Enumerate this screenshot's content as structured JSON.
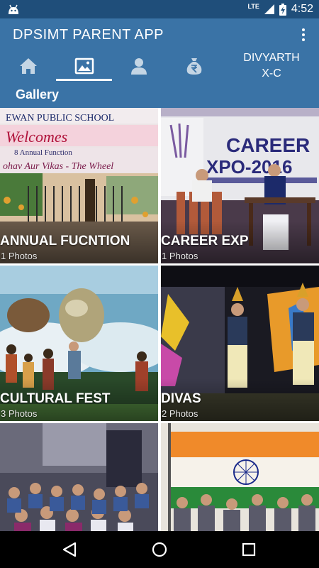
{
  "status_bar": {
    "network": "LTE",
    "time": "4:52"
  },
  "app_bar": {
    "title": "DPSIMT PARENT APP",
    "tabs": [
      {
        "name": "home",
        "icon": "home-icon"
      },
      {
        "name": "gallery",
        "icon": "gallery-icon",
        "selected": true
      },
      {
        "name": "profile",
        "icon": "person-icon"
      },
      {
        "name": "fees",
        "icon": "rupee-bag-icon"
      }
    ],
    "student": {
      "name": "DIVYARTH",
      "class": "X-C"
    },
    "section_label": "Gallery"
  },
  "gallery": {
    "albums": [
      {
        "title": "ANNUAL FUCNTION",
        "count": "1 Photos"
      },
      {
        "title": "CAREER EXP",
        "count": "1 Photos"
      },
      {
        "title": "CULTURAL FEST",
        "count": "3 Photos"
      },
      {
        "title": "DIVAS",
        "count": "2 Photos"
      },
      {
        "title": "",
        "count": ""
      },
      {
        "title": "",
        "count": ""
      }
    ]
  },
  "colors": {
    "status_bar": "#1f4e7a",
    "app_bar": "#3a73a6",
    "nav_bar": "#000000"
  }
}
